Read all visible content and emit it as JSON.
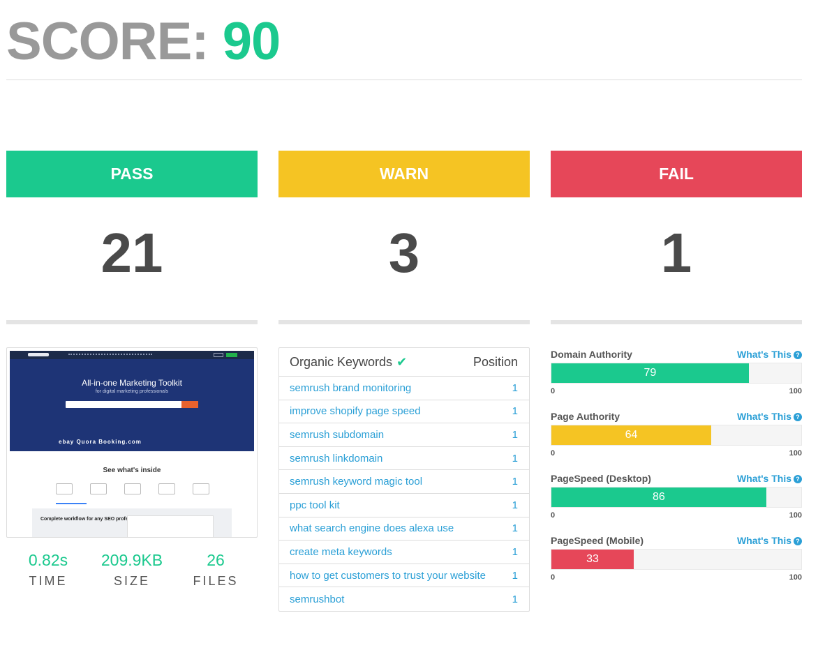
{
  "score": {
    "label": "SCORE:",
    "value": "90"
  },
  "colors": {
    "pass": "#1bc98e",
    "warn": "#f5c423",
    "fail": "#e64759"
  },
  "status": [
    {
      "label": "PASS",
      "count": "21"
    },
    {
      "label": "WARN",
      "count": "3"
    },
    {
      "label": "FAIL",
      "count": "1"
    }
  ],
  "screenshot": {
    "hero_title": "All-in-one Marketing Toolkit",
    "hero_subtitle": "for digital marketing professionals",
    "trusted_logos": "ebay  Quora  Booking.com",
    "section_title": "See what's inside",
    "panel_title": "Complete workflow for any SEO professional"
  },
  "metrics": [
    {
      "value": "0.82s",
      "label": "TIME"
    },
    {
      "value": "209.9KB",
      "label": "SIZE"
    },
    {
      "value": "26",
      "label": "FILES"
    }
  ],
  "keywords": {
    "header": "Organic Keywords",
    "check_icon": "check-icon",
    "position_header": "Position",
    "rows": [
      {
        "keyword": "semrush brand monitoring",
        "position": "1"
      },
      {
        "keyword": "improve shopify page speed",
        "position": "1"
      },
      {
        "keyword": "semrush subdomain",
        "position": "1"
      },
      {
        "keyword": "semrush linkdomain",
        "position": "1"
      },
      {
        "keyword": "semrush keyword magic tool",
        "position": "1"
      },
      {
        "keyword": "ppc tool kit",
        "position": "1"
      },
      {
        "keyword": "what search engine does alexa use",
        "position": "1"
      },
      {
        "keyword": "create meta keywords",
        "position": "1"
      },
      {
        "keyword": "how to get customers to trust your website",
        "position": "1"
      },
      {
        "keyword": "semrushbot",
        "position": "1"
      }
    ]
  },
  "authority": [
    {
      "title": "Domain Authority",
      "link": "What's This",
      "value": "79",
      "percent": 79,
      "color": "#1bc98e",
      "min": "0",
      "max": "100"
    },
    {
      "title": "Page Authority",
      "link": "What's This",
      "value": "64",
      "percent": 64,
      "color": "#f5c423",
      "min": "0",
      "max": "100"
    },
    {
      "title": "PageSpeed (Desktop)",
      "link": "What's This",
      "value": "86",
      "percent": 86,
      "color": "#1bc98e",
      "min": "0",
      "max": "100"
    },
    {
      "title": "PageSpeed (Mobile)",
      "link": "What's This",
      "value": "33",
      "percent": 33,
      "color": "#e64759",
      "min": "0",
      "max": "100"
    }
  ]
}
